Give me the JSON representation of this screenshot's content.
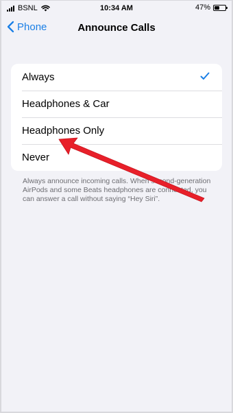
{
  "status_bar": {
    "carrier": "BSNL",
    "time": "10:34 AM",
    "battery_percent": "47%",
    "battery_level": 0.47,
    "signal_icon": "signal-bars-icon",
    "wifi_icon": "wifi-icon",
    "battery_icon": "battery-icon"
  },
  "nav": {
    "back_label": "Phone",
    "back_icon": "chevron-left-icon",
    "title": "Announce Calls"
  },
  "options": {
    "items": [
      {
        "label": "Always",
        "selected": true
      },
      {
        "label": "Headphones & Car",
        "selected": false
      },
      {
        "label": "Headphones Only",
        "selected": false
      },
      {
        "label": "Never",
        "selected": false
      }
    ],
    "check_icon": "checkmark-icon"
  },
  "footer": {
    "text": "Always announce incoming calls. When second-generation AirPods and some Beats headphones are connected, you can answer a call without saying “Hey Siri”."
  },
  "annotation": {
    "icon": "red-arrow-icon",
    "target": "Never",
    "color": "#e8202a"
  },
  "colors": {
    "accent": "#1a7fe6",
    "background": "#f2f2f7",
    "card": "#ffffff",
    "secondary_text": "#6d6d72"
  }
}
